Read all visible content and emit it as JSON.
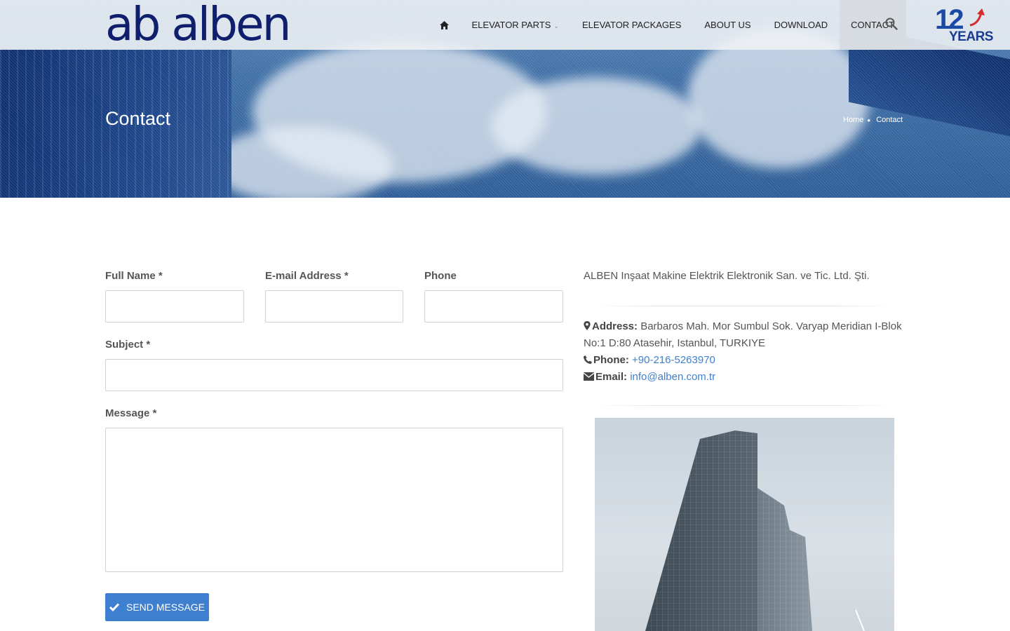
{
  "header": {
    "logo_text": "ab alben",
    "nav": [
      {
        "label": "Elevator Parts",
        "has_dropdown": true
      },
      {
        "label": "Elevator Packages"
      },
      {
        "label": "About Us"
      },
      {
        "label": "Download"
      },
      {
        "label": "Contact",
        "active": true
      }
    ],
    "badge": {
      "number": "12",
      "text": "YEARS"
    }
  },
  "hero": {
    "title": "Contact",
    "breadcrumb": [
      "Home",
      "Contact"
    ]
  },
  "form": {
    "full_name_label": "Full Name *",
    "email_label": "E-mail Address *",
    "phone_label": "Phone",
    "subject_label": "Subject *",
    "message_label": "Message *",
    "full_name_value": "",
    "email_value": "",
    "phone_value": "",
    "subject_value": "",
    "message_value": "",
    "send_label": "Send Message"
  },
  "sidebar": {
    "company": "ALBEN Inşaat Makine Elektrik Elektronik San. ve Tic. Ltd. Şti.",
    "address_label": "Address:",
    "address_line1": "Barbaros Mah. Mor Sumbul Sok. Varyap Meridian I-Blok",
    "address_line2": "No:1 D:80 Atasehir, Istanbul, TURKIYE",
    "phone_label": "Phone:",
    "phone_value": "+90-216-5263970",
    "email_label": "Email:",
    "email_value": "info@alben.com.tr"
  },
  "colors": {
    "accent": "#3f7fcf",
    "logo": "#0f1f6e",
    "hero": "#3f6fa6"
  },
  "icons": [
    "home-icon",
    "chevron-down-icon",
    "search-icon",
    "map-marker-icon",
    "phone-icon",
    "envelope-icon",
    "check-icon"
  ]
}
